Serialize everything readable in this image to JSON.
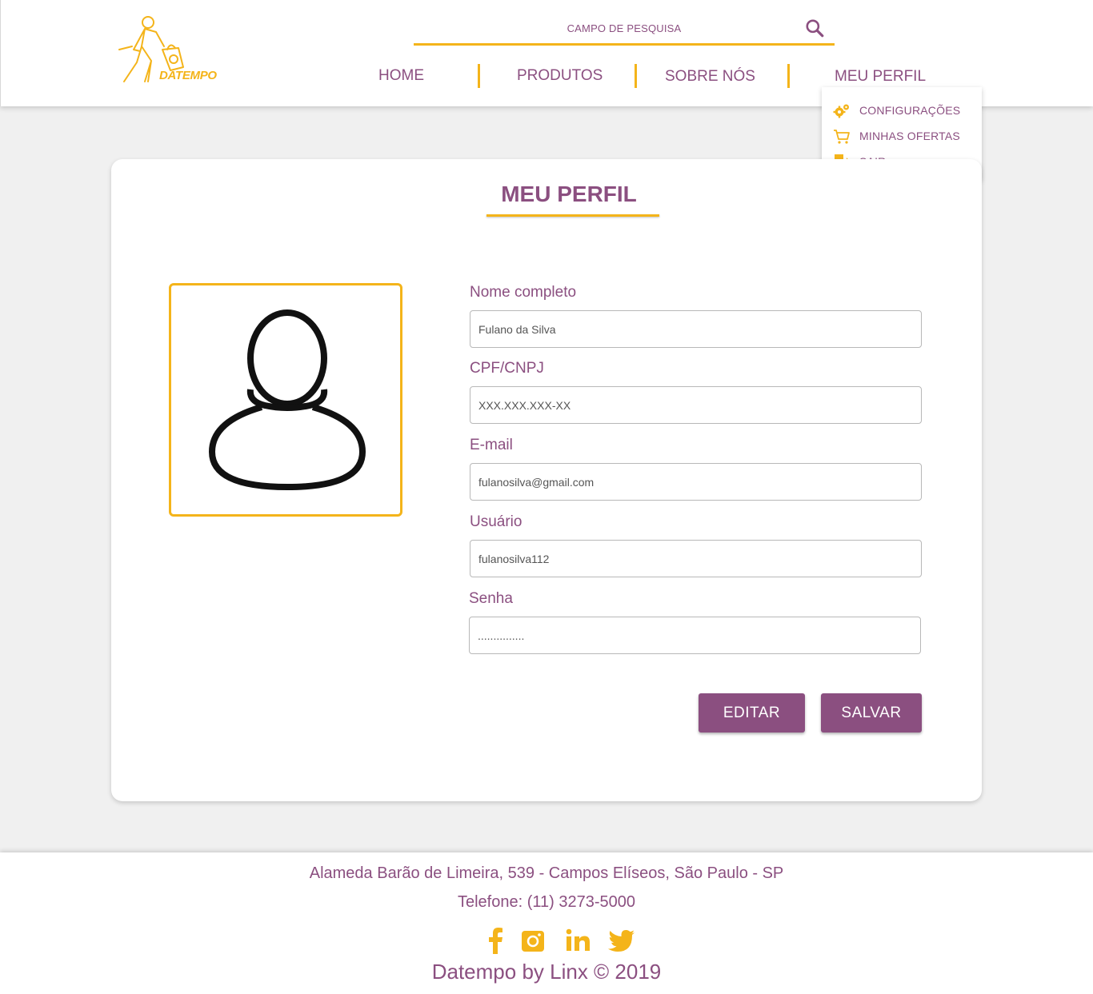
{
  "brand": {
    "logo_text": "DATEMPO"
  },
  "search": {
    "placeholder": "CAMPO DE PESQUISA"
  },
  "nav": {
    "items": [
      {
        "label": "HOME"
      },
      {
        "label": "PRODUTOS"
      },
      {
        "label": "SOBRE NÓS"
      },
      {
        "label": "MEU PERFIL"
      }
    ]
  },
  "profile_menu": {
    "items": [
      {
        "label": "CONFIGURAÇÕES",
        "icon": "gears-icon"
      },
      {
        "label": "MINHAS OFERTAS",
        "icon": "cart-icon"
      },
      {
        "label": "SAIR",
        "icon": "exit-door-icon"
      }
    ]
  },
  "page": {
    "title": "MEU PERFIL"
  },
  "form": {
    "fields": [
      {
        "label": "Nome completo",
        "value": "Fulano da Silva"
      },
      {
        "label": "CPF/CNPJ",
        "value": "XXX.XXX.XXX-XX"
      },
      {
        "label": "E-mail",
        "value": "fulanosilva@gmail.com"
      },
      {
        "label": "Usuário",
        "value": "fulanosilva112"
      },
      {
        "label": "Senha",
        "value": "..............."
      }
    ],
    "edit_label": "EDITAR",
    "save_label": "SALVAR"
  },
  "footer": {
    "address": "Alameda Barão de Limeira, 539 - Campos Elíseos, São Paulo - SP",
    "phone": "Telefone: (11) 3273-5000",
    "copyright": "Datempo by Linx © 2019",
    "social": [
      "facebook-icon",
      "instagram-icon",
      "linkedin-icon",
      "twitter-icon"
    ]
  },
  "colors": {
    "primary": "#8b4f80",
    "accent": "#f4b41a",
    "background": "#f0f0f0"
  }
}
